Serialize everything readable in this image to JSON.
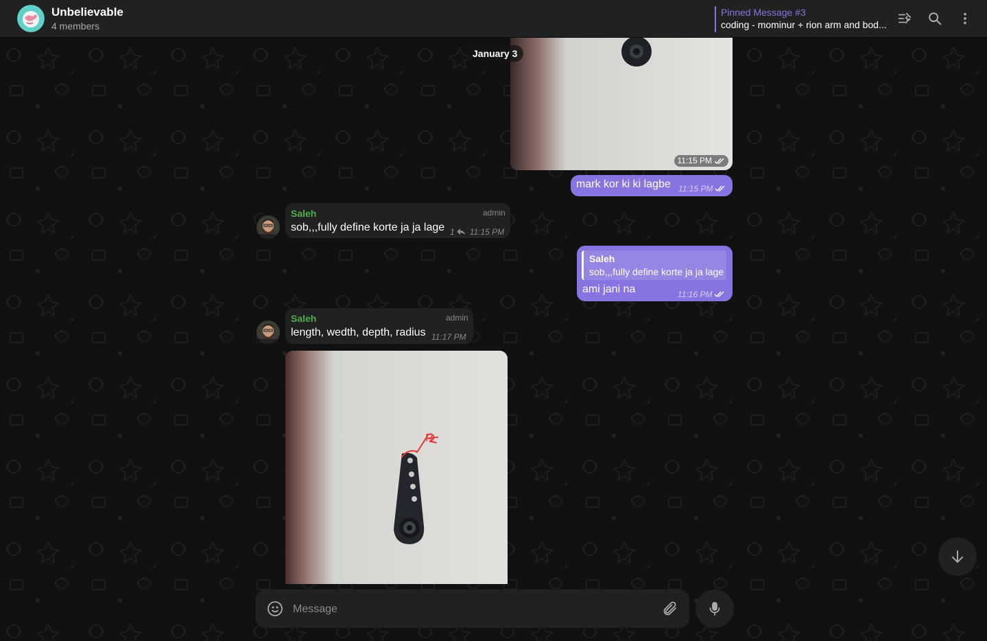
{
  "header": {
    "title": "Unbelievable",
    "members": "4 members",
    "pinned_title": "Pinned Message #3",
    "pinned_text": "coding - mominur + rion arm and bod..."
  },
  "date_separator": "January 3",
  "messages": [
    {
      "type": "photo",
      "direction": "outgoing",
      "time": "11:15 PM",
      "status": "read"
    },
    {
      "type": "text",
      "direction": "outgoing",
      "text": "mark kor ki ki lagbe",
      "time": "11:15 PM",
      "status": "read"
    },
    {
      "type": "text",
      "direction": "incoming",
      "sender": "Saleh",
      "role": "admin",
      "text": "sob,,,fully define korte ja ja lage",
      "replies": "1",
      "time": "11:15 PM"
    },
    {
      "type": "text",
      "direction": "outgoing",
      "reply_to": {
        "sender": "Saleh",
        "text": "sob,,,fully define korte ja ja lage"
      },
      "text": "ami jani na",
      "time": "11:16 PM",
      "status": "read"
    },
    {
      "type": "text",
      "direction": "incoming",
      "sender": "Saleh",
      "role": "admin",
      "text": "length, wedth, depth, radius",
      "time": "11:17 PM"
    },
    {
      "type": "photo",
      "direction": "incoming",
      "annotation": "R"
    }
  ],
  "composer": {
    "placeholder": "Message"
  },
  "icons": {
    "pinned_list": "pinned-list-icon",
    "search": "search-icon",
    "more": "more-vertical-icon",
    "emoji": "emoji-icon",
    "attach": "paperclip-icon",
    "mic": "microphone-icon",
    "scroll_down": "arrow-down-icon"
  },
  "colors": {
    "accent": "#8774e1",
    "sender_name": "#4fae4e",
    "header_bg": "#212121",
    "chat_bg": "#111111"
  }
}
